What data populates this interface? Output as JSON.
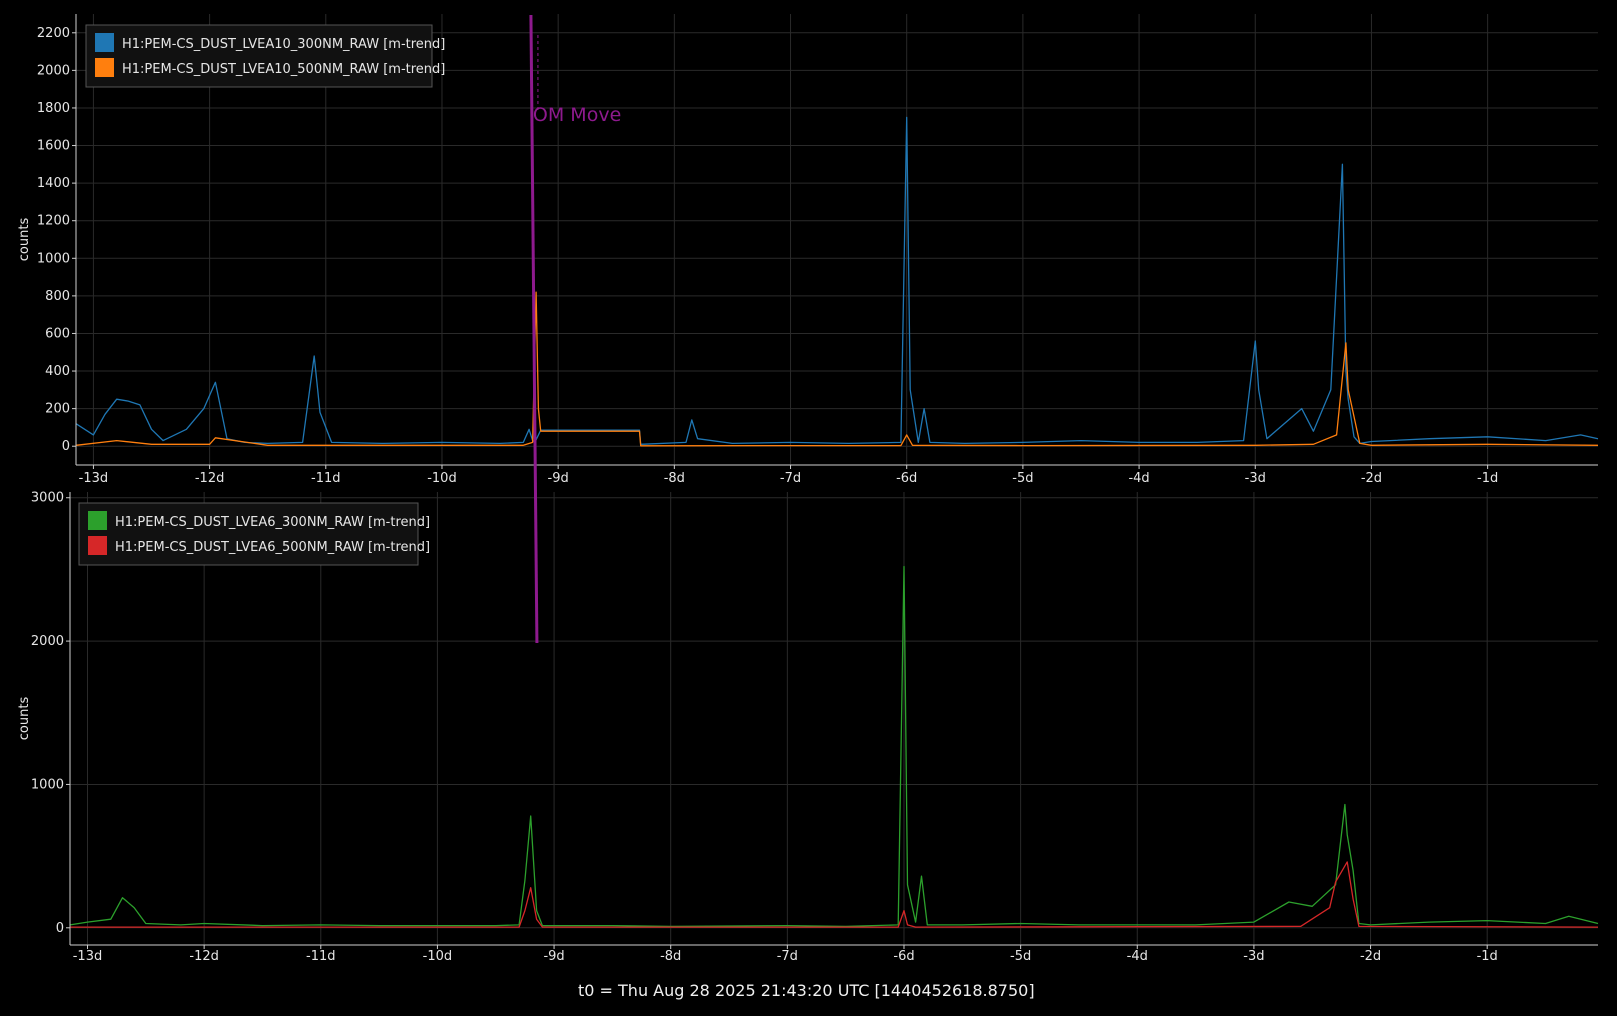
{
  "footer": "t0 = Thu Aug 28 2025 21:43:20 UTC [1440452618.8750]",
  "chart_data": [
    {
      "type": "line",
      "ylabel": "counts",
      "xlim": [
        -13.15,
        -0.05
      ],
      "ylim": [
        -100,
        2300
      ],
      "yticks": [
        0,
        200,
        400,
        600,
        800,
        1000,
        1200,
        1400,
        1600,
        1800,
        2000,
        2200
      ],
      "xticks": [
        -13,
        -12,
        -11,
        -10,
        -9,
        -8,
        -7,
        -6,
        -5,
        -4,
        -3,
        -2,
        -1
      ],
      "xtick_labels": [
        "-13d",
        "-12d",
        "-11d",
        "-10d",
        "-9d",
        "-8d",
        "-7d",
        "-6d",
        "-5d",
        "-4d",
        "-3d",
        "-2d",
        "-1d"
      ],
      "grid": true,
      "legend_position": "top-left",
      "series": [
        {
          "name": "H1:PEM-CS_DUST_LVEA10_300NM_RAW [m-trend]",
          "color": "#1f77b4",
          "x": [
            -13.15,
            -13.0,
            -12.9,
            -12.8,
            -12.7,
            -12.6,
            -12.5,
            -12.4,
            -12.2,
            -12.05,
            -11.95,
            -11.85,
            -11.7,
            -11.5,
            -11.2,
            -11.1,
            -11.05,
            -10.95,
            -10.5,
            -10.0,
            -9.5,
            -9.3,
            -9.25,
            -9.22,
            -9.2,
            -9.15,
            -8.3,
            -8.29,
            -7.9,
            -7.85,
            -7.8,
            -7.5,
            -7.0,
            -6.5,
            -6.05,
            -6.0,
            -5.97,
            -5.9,
            -5.85,
            -5.8,
            -5.5,
            -5.0,
            -4.5,
            -4.0,
            -3.5,
            -3.1,
            -3.0,
            -2.97,
            -2.9,
            -2.6,
            -2.5,
            -2.35,
            -2.25,
            -2.22,
            -2.2,
            -2.15,
            -2.1,
            -2.0,
            -1.5,
            -1.0,
            -0.5,
            -0.2,
            -0.05
          ],
          "values": [
            120,
            60,
            170,
            250,
            240,
            220,
            90,
            30,
            90,
            200,
            340,
            40,
            20,
            15,
            20,
            480,
            180,
            20,
            15,
            20,
            15,
            20,
            90,
            30,
            20,
            85,
            85,
            10,
            20,
            140,
            40,
            15,
            20,
            15,
            20,
            1750,
            300,
            20,
            200,
            20,
            15,
            20,
            30,
            20,
            20,
            30,
            560,
            300,
            40,
            200,
            80,
            300,
            1500,
            400,
            250,
            50,
            15,
            25,
            40,
            50,
            30,
            60,
            40
          ]
        },
        {
          "name": "H1:PEM-CS_DUST_LVEA10_500NM_RAW [m-trend]",
          "color": "#ff7f0e",
          "x": [
            -13.15,
            -12.8,
            -12.5,
            -12.0,
            -11.95,
            -11.5,
            -10.0,
            -9.3,
            -9.22,
            -9.19,
            -9.17,
            -9.15,
            -8.3,
            -8.29,
            -7.0,
            -6.05,
            -6.0,
            -5.95,
            -5.0,
            -3.0,
            -2.5,
            -2.3,
            -2.22,
            -2.2,
            -2.1,
            -2.0,
            -1.0,
            -0.05
          ],
          "values": [
            5,
            30,
            10,
            10,
            45,
            5,
            5,
            5,
            20,
            820,
            200,
            80,
            80,
            2,
            3,
            3,
            60,
            5,
            3,
            5,
            10,
            60,
            550,
            300,
            15,
            5,
            10,
            5
          ]
        }
      ],
      "annotations": [
        {
          "text": "OM Move",
          "x": -9.2,
          "color": "#8e1a8e"
        }
      ]
    },
    {
      "type": "line",
      "ylabel": "counts",
      "xlim": [
        -13.15,
        -0.05
      ],
      "ylim": [
        -120,
        3040
      ],
      "yticks": [
        0,
        1000,
        2000,
        3000
      ],
      "xticks": [
        -13,
        -12,
        -11,
        -10,
        -9,
        -8,
        -7,
        -6,
        -5,
        -4,
        -3,
        -2,
        -1
      ],
      "xtick_labels": [
        "-13d",
        "-12d",
        "-11d",
        "-10d",
        "-9d",
        "-8d",
        "-7d",
        "-6d",
        "-5d",
        "-4d",
        "-3d",
        "-2d",
        "-1d"
      ],
      "grid": true,
      "legend_position": "top-left",
      "series": [
        {
          "name": "H1:PEM-CS_DUST_LVEA6_300NM_RAW [m-trend]",
          "color": "#2ca02c",
          "x": [
            -13.15,
            -13.0,
            -12.8,
            -12.7,
            -12.6,
            -12.5,
            -12.2,
            -12.0,
            -11.5,
            -11.0,
            -10.5,
            -10.0,
            -9.5,
            -9.3,
            -9.25,
            -9.2,
            -9.15,
            -9.1,
            -8.5,
            -8.0,
            -7.0,
            -6.5,
            -6.05,
            -6.0,
            -5.97,
            -5.9,
            -5.85,
            -5.8,
            -5.5,
            -5.0,
            -4.5,
            -4.0,
            -3.5,
            -3.0,
            -2.7,
            -2.5,
            -2.3,
            -2.22,
            -2.2,
            -2.15,
            -2.1,
            -2.0,
            -1.5,
            -1.0,
            -0.5,
            -0.3,
            -0.05
          ],
          "values": [
            20,
            40,
            60,
            210,
            140,
            30,
            20,
            30,
            15,
            20,
            15,
            15,
            15,
            20,
            330,
            780,
            120,
            15,
            15,
            10,
            15,
            10,
            20,
            2520,
            300,
            40,
            360,
            20,
            20,
            30,
            20,
            20,
            20,
            40,
            180,
            150,
            300,
            860,
            650,
            400,
            30,
            20,
            40,
            50,
            30,
            80,
            30
          ]
        },
        {
          "name": "H1:PEM-CS_DUST_LVEA6_500NM_RAW [m-trend]",
          "color": "#d62728",
          "x": [
            -13.15,
            -12.0,
            -9.3,
            -9.25,
            -9.2,
            -9.15,
            -9.1,
            -6.05,
            -6.0,
            -5.97,
            -5.9,
            -2.6,
            -2.35,
            -2.3,
            -2.2,
            -2.15,
            -2.1,
            -0.05
          ],
          "values": [
            5,
            5,
            5,
            120,
            280,
            60,
            5,
            5,
            120,
            20,
            5,
            10,
            140,
            320,
            460,
            200,
            10,
            5
          ]
        }
      ],
      "annotations": []
    }
  ]
}
